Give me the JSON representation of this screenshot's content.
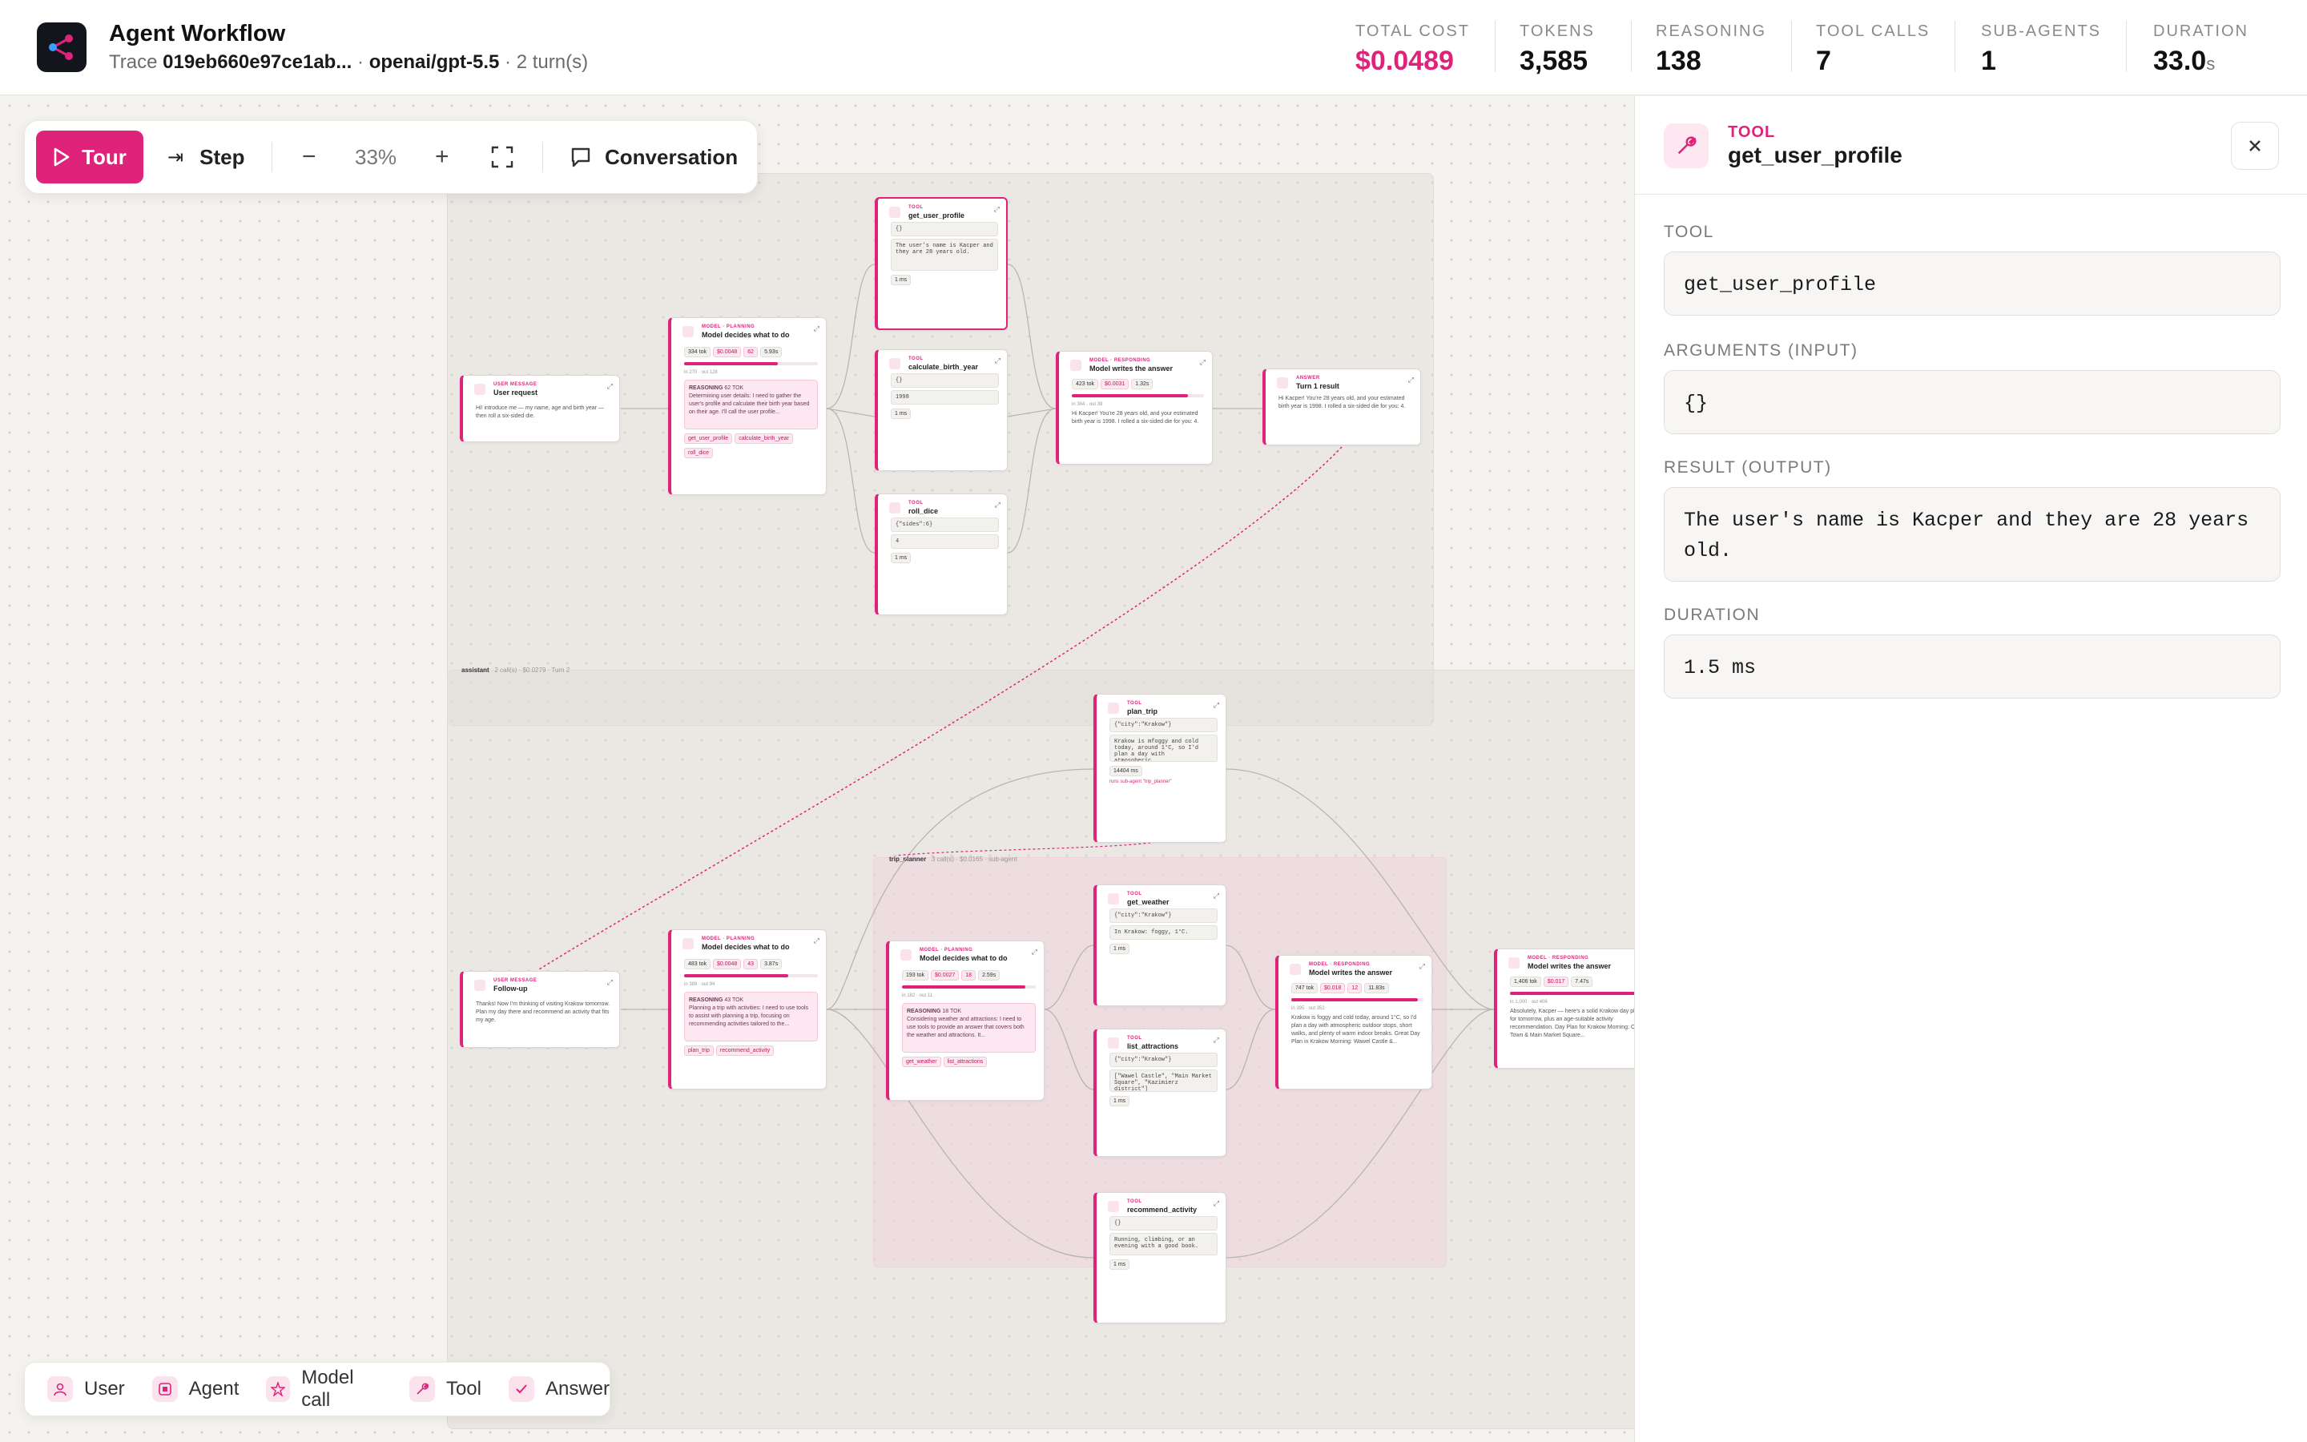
{
  "header": {
    "title": "Agent Workflow",
    "trace_prefix": "Trace",
    "trace_id": "019eb660e97ce1ab...",
    "sep1": "·",
    "model": "openai/gpt-5.5",
    "sep2": "·",
    "turns": "2 turn(s)"
  },
  "stats": [
    {
      "label": "TOTAL COST",
      "value": "$0.0489",
      "color": "#e0237a"
    },
    {
      "label": "TOKENS",
      "value": "3,585"
    },
    {
      "label": "REASONING",
      "value": "138"
    },
    {
      "label": "TOOL CALLS",
      "value": "7"
    },
    {
      "label": "SUB-AGENTS",
      "value": "1"
    },
    {
      "label": "DURATION",
      "value": "33.0",
      "unit": "s"
    }
  ],
  "toolbar": {
    "tour": "Tour",
    "step": "Step",
    "zoom": "33%",
    "conversation": "Conversation"
  },
  "legend": [
    "User",
    "Agent",
    "Model call",
    "Tool",
    "Answer"
  ],
  "panel": {
    "kind": "TOOL",
    "name": "get_user_profile",
    "fields": [
      {
        "label": "TOOL",
        "value": "get_user_profile"
      },
      {
        "label": "ARGUMENTS (INPUT)",
        "value": "{}"
      },
      {
        "label": "RESULT (OUTPUT)",
        "value": "The user's name is Kacper and they are 28 years old."
      },
      {
        "label": "DURATION",
        "value": "1.5 ms"
      }
    ]
  },
  "graph": {
    "turn2_label": "assistant",
    "turn2_meta": "2 call(s) · $0.0279 · Turn 2",
    "sub_label": "trip_planner",
    "sub_meta": "3 call(s) · $0.0165 · sub-agent",
    "user1": {
      "kind": "USER MESSAGE",
      "name": "User request",
      "text": "Hi! introduce me — my name, age and birth year — then roll a six-sided die."
    },
    "plan1": {
      "kind": "MODEL · PLANNING",
      "name": "Model decides what to do",
      "tok": "334 tok",
      "cost": "$0.0048",
      "reason": "62",
      "time": "5.93s",
      "in": "in 270",
      "out": "out 128",
      "reason_label": "REASONING",
      "reason_count": "62 TOK",
      "reason_text": "Determining user details: I need to gather the user's profile and calculate their birth year based on their age. I'll call the user profile...",
      "tags": [
        "get_user_profile",
        "calculate_birth_year",
        "roll_dice"
      ]
    },
    "tool_profile": {
      "kind": "TOOL",
      "name": "get_user_profile",
      "input": "{}",
      "output": "The user's name is Kacper and they are 28 years old.",
      "dur": "1 ms"
    },
    "tool_birth": {
      "kind": "TOOL",
      "name": "calculate_birth_year",
      "input": "{}",
      "output": "1998",
      "dur": "1 ms"
    },
    "tool_dice": {
      "kind": "TOOL",
      "name": "roll_dice",
      "input": "{\"sides\":6}",
      "output": "4",
      "dur": "1 ms"
    },
    "resp1": {
      "kind": "MODEL · RESPONDING",
      "name": "Model writes the answer",
      "tok": "423 tok",
      "cost": "$0.0031",
      "time": "1.32s",
      "in": "in 384",
      "out": "out 39",
      "text": "Hi Kacper! You're 28 years old, and your estimated birth year is 1998. I rolled a six-sided die for you: 4."
    },
    "answer1": {
      "kind": "ANSWER",
      "name": "Turn 1 result",
      "text": "Hi Kacper! You're 28 years old, and your estimated birth year is 1998. I rolled a six-sided die for you: 4."
    },
    "user2": {
      "kind": "USER MESSAGE",
      "name": "Follow-up",
      "text": "Thanks! Now I'm thinking of visiting Krakow tomorrow. Plan my day there and recommend an activity that fits my age."
    },
    "plan2": {
      "kind": "MODEL · PLANNING",
      "name": "Model decides what to do",
      "tok": "483 tok",
      "cost": "$0.0048",
      "reason": "43",
      "time": "3.87s",
      "in": "in 389",
      "out": "out 94",
      "reason_label": "REASONING",
      "reason_count": "43 TOK",
      "reason_text": "Planning a trip with activities: I need to use tools to assist with planning a trip, focusing on recommending activities tailored to the...",
      "tags": [
        "plan_trip",
        "recommend_activity"
      ]
    },
    "tool_trip": {
      "kind": "TOOL",
      "name": "plan_trip",
      "input": "{\"city\":\"Krakow\"}",
      "output": "Krakow is mfoggy and cold today, around 1°C, so I'd plan a day with atmospheric...",
      "dur": "14404 ms",
      "note": "runs sub-agent \"trip_planner\""
    },
    "plan3": {
      "kind": "MODEL · PLANNING",
      "name": "Model decides what to do",
      "tok": "193 tok",
      "cost": "$0.0027",
      "reason": "18",
      "time": "2.59s",
      "in": "in 182",
      "out": "out 11",
      "reason_label": "REASONING",
      "reason_count": "18 TOK",
      "reason_text": "Considering weather and attractions: I need to use tools to provide an answer that covers both the weather and attractions. It...",
      "tags": [
        "get_weather",
        "list_attractions"
      ]
    },
    "tool_weather": {
      "kind": "TOOL",
      "name": "get_weather",
      "input": "{\"city\":\"Krakow\"}",
      "output": "In Krakow: foggy, 1°C.",
      "dur": "1 ms"
    },
    "tool_attr": {
      "kind": "TOOL",
      "name": "list_attractions",
      "input": "{\"city\":\"Krakow\"}",
      "output": "[\"Wawel Castle\", \"Main Market Square\", \"Kazimierz district\"]",
      "dur": "1 ms"
    },
    "resp3": {
      "kind": "MODEL · RESPONDING",
      "name": "Model writes the answer",
      "tok": "747 tok",
      "cost": "$0.018",
      "reason": "12",
      "time": "11.83s",
      "in": "in 395",
      "out": "out 352",
      "text": "Krakow is foggy and cold today, around 1°C, so I'd plan a day with atmospheric outdoor stops, short walks, and plenty of warm indoor breaks. Great Day Plan in Krakow Morning: Wawel Castle &..."
    },
    "tool_rec": {
      "kind": "TOOL",
      "name": "recommend_activity",
      "input": "{}",
      "output": "Running, climbing, or an evening with a good book.",
      "dur": "1 ms"
    },
    "resp2": {
      "kind": "MODEL · RESPONDING",
      "name": "Model writes the answer",
      "tok": "1,406 tok",
      "cost": "$0.017",
      "time": "7.47s",
      "in": "in 1,000",
      "out": "out 406",
      "text": "Absolutely, Kacper — here's a solid Krakow day plan for tomorrow, plus an age-suitable activity recommendation. Day Plan for Krakow Morning: Old Town & Main Market Square..."
    }
  }
}
